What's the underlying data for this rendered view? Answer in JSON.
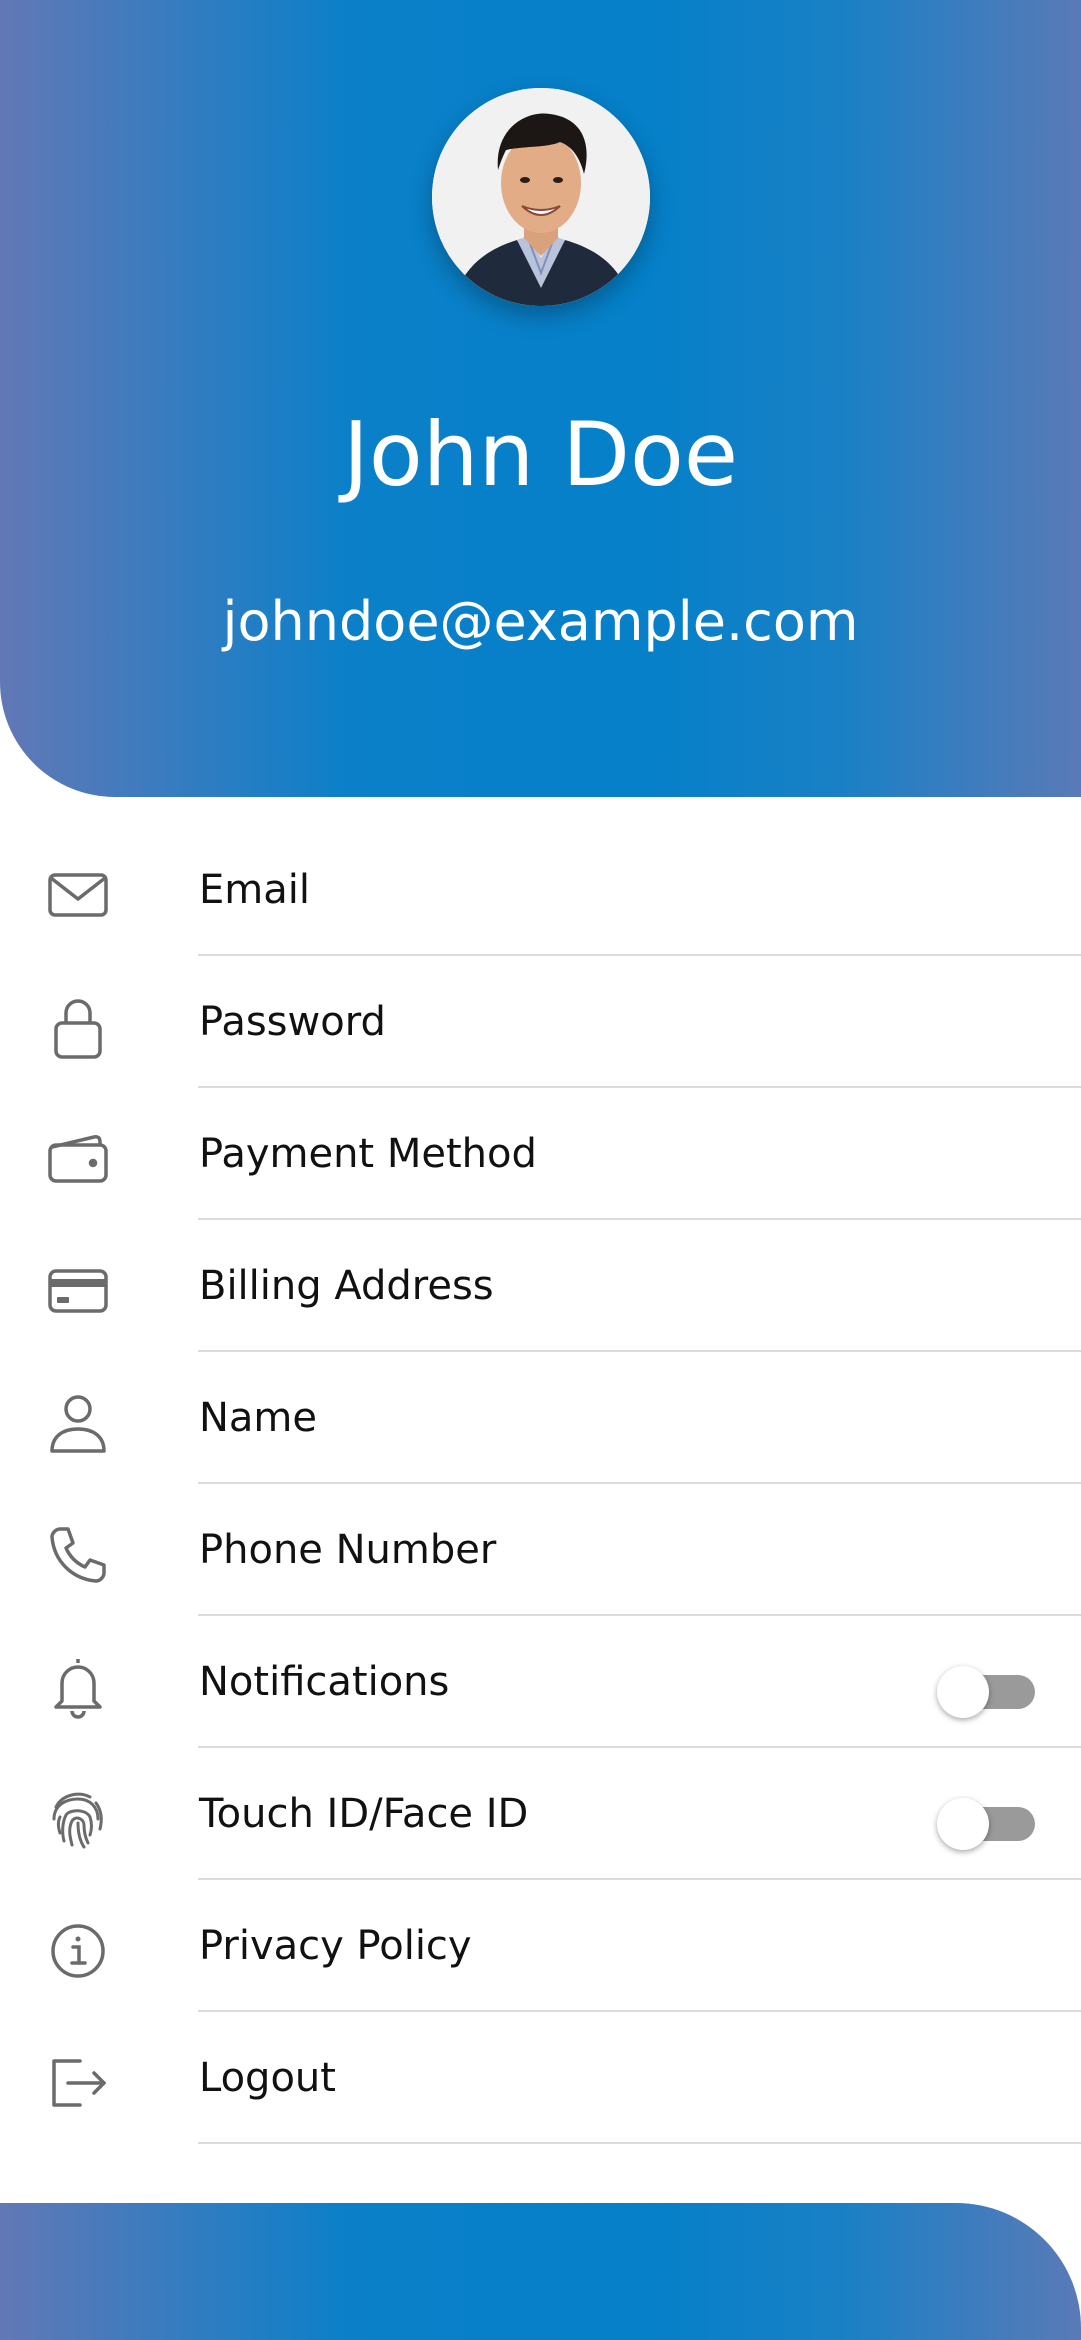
{
  "profile": {
    "name": "John Doe",
    "email": "johndoe@example.com"
  },
  "colors": {
    "header_gradient_left": "#6278b6",
    "header_gradient_center": "#0580c9",
    "icon": "#6b6b6b",
    "divider": "#dcdcdc",
    "toggle_off_track": "#9a9a9a"
  },
  "menu": {
    "items": [
      {
        "label": "Email",
        "icon": "envelope-icon"
      },
      {
        "label": "Password",
        "icon": "lock-icon"
      },
      {
        "label": "Payment Method",
        "icon": "wallet-icon"
      },
      {
        "label": "Billing Address",
        "icon": "credit-card-icon"
      },
      {
        "label": "Name",
        "icon": "user-icon"
      },
      {
        "label": "Phone Number",
        "icon": "phone-icon"
      },
      {
        "label": "Notifications",
        "icon": "bell-icon",
        "toggle": false
      },
      {
        "label": "Touch ID/Face ID",
        "icon": "fingerprint-icon",
        "toggle": false
      },
      {
        "label": "Privacy Policy",
        "icon": "info-icon"
      },
      {
        "label": "Logout",
        "icon": "logout-icon"
      }
    ]
  }
}
